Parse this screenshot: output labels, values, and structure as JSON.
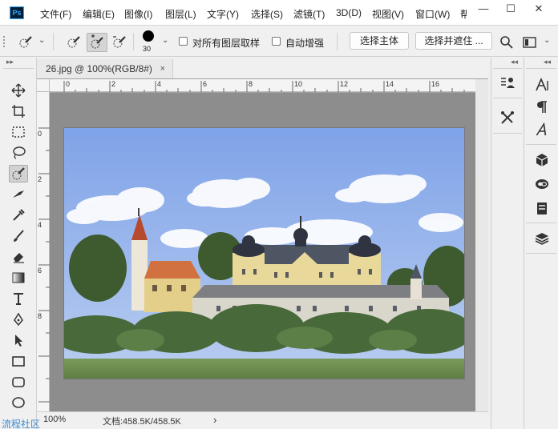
{
  "app": {
    "logo": "Ps"
  },
  "menu": [
    "文件(F)",
    "编辑(E)",
    "图像(I)",
    "图层(L)",
    "文字(Y)",
    "选择(S)",
    "滤镜(T)",
    "3D(D)",
    "视图(V)",
    "窗口(W)",
    "帮"
  ],
  "window_controls": {
    "minimize": "—",
    "maximize": "☐",
    "close": "✕"
  },
  "options": {
    "brush_size": "30",
    "sample_all_layers_label": "对所有图层取样",
    "auto_enhance_label": "自动增强",
    "select_subject_label": "选择主体",
    "select_and_mask_label": "选择并遮住 ..."
  },
  "document": {
    "tab_title": "26.jpg @ 100%(RGB/8#)",
    "tab_close": "×",
    "ruler_h_ticks": [
      "0",
      "2",
      "4",
      "6",
      "8",
      "10",
      "12",
      "14",
      "16"
    ],
    "ruler_v_ticks": [
      "0",
      "2",
      "4",
      "6",
      "8"
    ]
  },
  "status": {
    "zoom": "100%",
    "doc_info": "文档:458.5K/458.5K",
    "arrow": "›"
  },
  "panels": {
    "collapse_left": "▸▸",
    "collapse_right": "◂◂"
  },
  "watermark": "流程社区",
  "colors": {
    "sky_top": "#7fa3e8",
    "sky_bottom": "#b9cdf0",
    "grass": "#6f8f52",
    "roof_orange": "#d0713f",
    "roof_slate": "#4e5664",
    "wall_yellow": "#e8d99b"
  }
}
